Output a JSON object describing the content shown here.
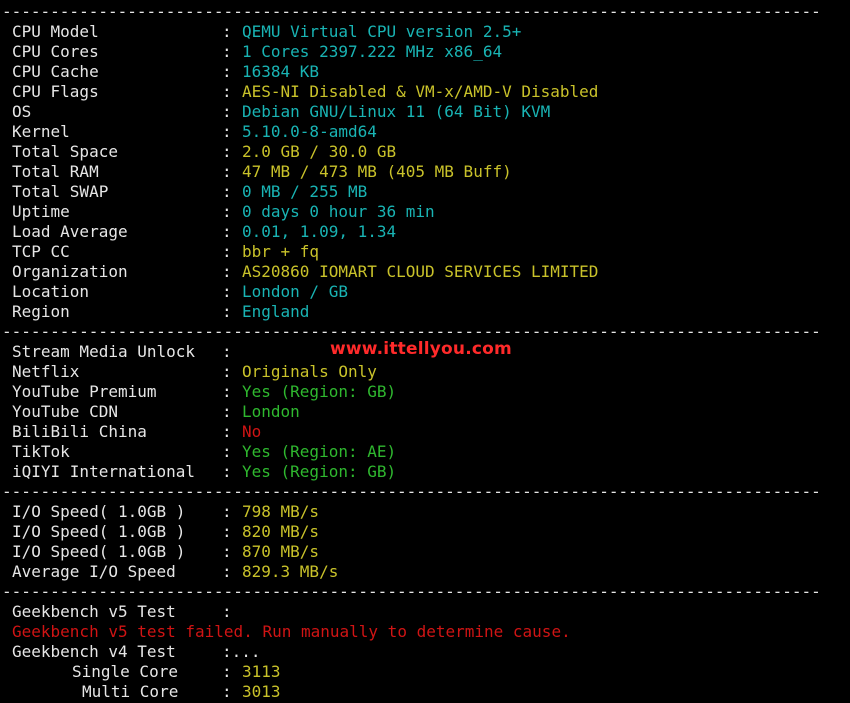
{
  "separator": "-------------------------------------------------------------------------------------",
  "system": [
    {
      "label": "CPU Model",
      "value": "QEMU Virtual CPU version 2.5+",
      "color": "cyan"
    },
    {
      "label": "CPU Cores",
      "value": "1 Cores 2397.222 MHz x86_64",
      "color": "cyan"
    },
    {
      "label": "CPU Cache",
      "value": "16384 KB",
      "color": "cyan"
    },
    {
      "label": "CPU Flags",
      "value": "AES-NI Disabled & VM-x/AMD-V Disabled",
      "color": "yellow"
    },
    {
      "label": "OS",
      "value": "Debian GNU/Linux 11 (64 Bit) KVM",
      "color": "cyan"
    },
    {
      "label": "Kernel",
      "value": "5.10.0-8-amd64",
      "color": "cyan"
    },
    {
      "label": "Total Space",
      "value": "2.0 GB / 30.0 GB",
      "color": "yellow"
    },
    {
      "label": "Total RAM",
      "value": "47 MB / 473 MB (405 MB Buff)",
      "color": "yellow"
    },
    {
      "label": "Total SWAP",
      "value": "0 MB / 255 MB",
      "color": "cyan"
    },
    {
      "label": "Uptime",
      "value": "0 days 0 hour 36 min",
      "color": "cyan"
    },
    {
      "label": "Load Average",
      "value": "0.01, 1.09, 1.34",
      "color": "cyan"
    },
    {
      "label": "TCP CC",
      "value": "bbr + fq",
      "color": "yellow"
    },
    {
      "label": "Organization",
      "value": "AS20860 IOMART CLOUD SERVICES LIMITED",
      "color": "yellow"
    },
    {
      "label": "Location",
      "value": "London / GB",
      "color": "cyan"
    },
    {
      "label": "Region",
      "value": "England",
      "color": "cyan"
    }
  ],
  "stream": [
    {
      "label": "Stream Media Unlock",
      "value": "",
      "color": "white"
    },
    {
      "label": "Netflix",
      "value": "Originals Only",
      "color": "yellow"
    },
    {
      "label": "YouTube Premium",
      "value": "Yes (Region: GB)",
      "color": "green"
    },
    {
      "label": "YouTube CDN",
      "value": "London",
      "color": "green"
    },
    {
      "label": "BiliBili China",
      "value": "No",
      "color": "red"
    },
    {
      "label": "TikTok",
      "value": "Yes (Region: AE)",
      "color": "green"
    },
    {
      "label": "iQIYI International",
      "value": "Yes (Region: GB)",
      "color": "green"
    }
  ],
  "io": [
    {
      "label": "I/O Speed( 1.0GB )",
      "value": "798 MB/s",
      "color": "yellow"
    },
    {
      "label": "I/O Speed( 1.0GB )",
      "value": "820 MB/s",
      "color": "yellow"
    },
    {
      "label": "I/O Speed( 1.0GB )",
      "value": "870 MB/s",
      "color": "yellow"
    },
    {
      "label": "Average I/O Speed",
      "value": "829.3 MB/s",
      "color": "yellow"
    }
  ],
  "geekbench": {
    "v5_label": "Geekbench v5 Test",
    "v5_colon": ":",
    "v5_error": "Geekbench v5 test failed. Run manually to determine cause.",
    "v4_label": "Geekbench v4 Test",
    "v4_colon": ":...",
    "single_label": "Single Core",
    "single_colon": ":",
    "single_value": "3113",
    "multi_label": "Multi Core",
    "multi_colon": ":",
    "multi_value": "3013"
  },
  "colon": ":",
  "watermark": "www.ittellyou.com",
  "colors": {
    "cyan": "#19b4b4",
    "yellow": "#c9c22a",
    "green": "#2fb82f",
    "red": "#d01414",
    "white": "#e6e6e6",
    "background": "#000000",
    "watermark": "#ff2a2a"
  }
}
